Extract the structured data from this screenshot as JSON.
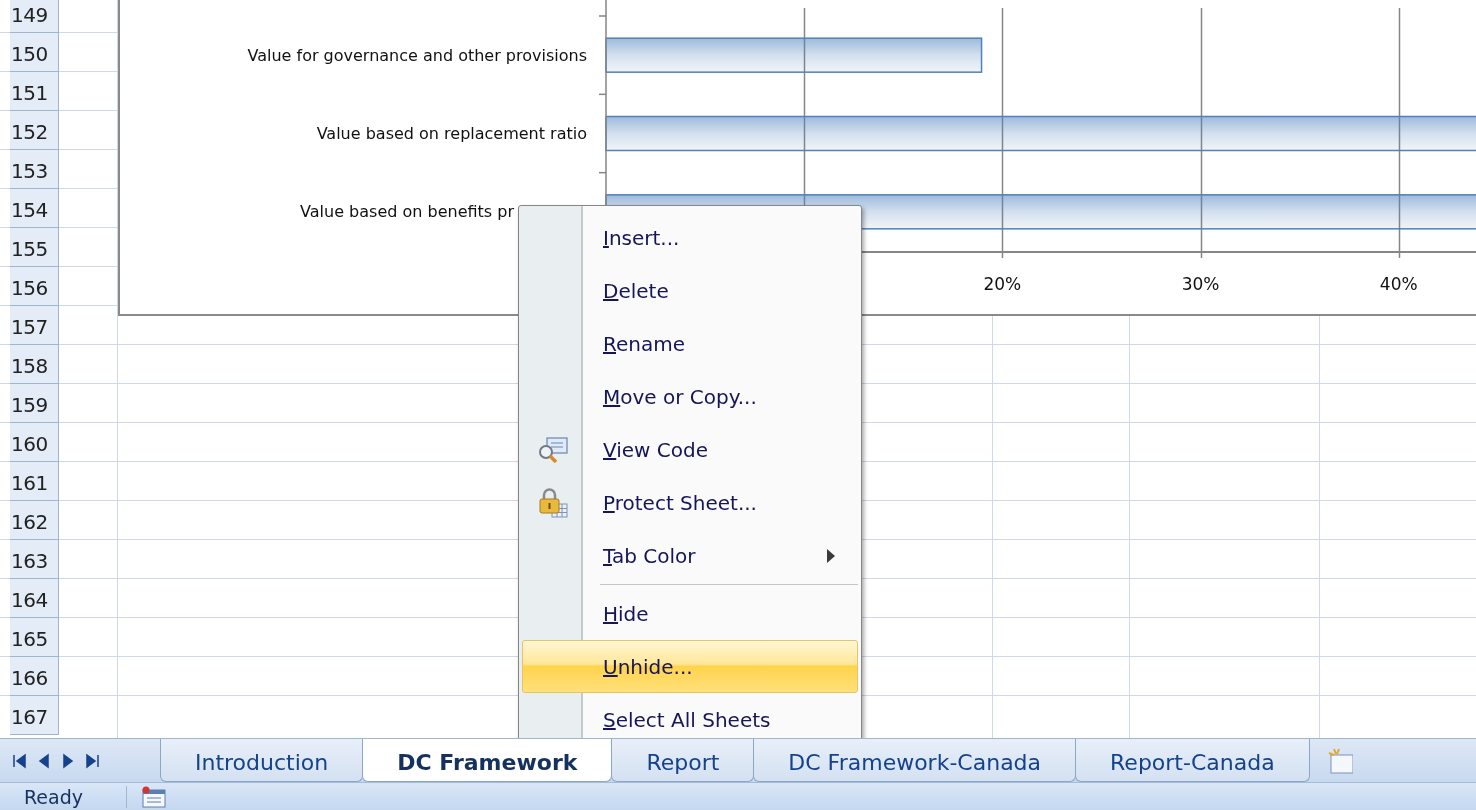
{
  "sheet": {
    "row_numbers": [
      "149",
      "150",
      "151",
      "152",
      "153",
      "154",
      "155",
      "156",
      "157",
      "158",
      "159",
      "160",
      "161",
      "162",
      "163",
      "164",
      "165",
      "166",
      "167"
    ]
  },
  "chart": {
    "category_labels": [
      "Value for governance and other provisions",
      "Value based on replacement ratio",
      "Value based on benefits pr"
    ],
    "chart_data": {
      "type": "bar",
      "orientation": "horizontal",
      "series": [
        {
          "color": "#4f81bd",
          "values": [
            0.19,
            0.44,
            0.44
          ]
        }
      ],
      "xlim": [
        0,
        0.44
      ],
      "grid": true,
      "xticks": [
        {
          "value": 0.2,
          "label": "20%"
        },
        {
          "value": 0.3,
          "label": "30%"
        },
        {
          "value": 0.4,
          "label": "40%"
        }
      ]
    }
  },
  "context_menu": {
    "items": [
      {
        "label": "Insert...",
        "underline_first": true,
        "kind": "plain",
        "selected": false,
        "separator_before": false
      },
      {
        "label": "Delete",
        "underline_first": true,
        "kind": "plain",
        "selected": false,
        "separator_before": false
      },
      {
        "label": "Rename",
        "underline_first": true,
        "kind": "plain",
        "selected": false,
        "separator_before": false
      },
      {
        "label": "Move or Copy...",
        "underline_first": true,
        "kind": "plain",
        "selected": false,
        "separator_before": false
      },
      {
        "label": "View Code",
        "underline_first": true,
        "kind": "code",
        "selected": false,
        "separator_before": false
      },
      {
        "label": "Protect Sheet...",
        "underline_first": true,
        "kind": "protect",
        "selected": false,
        "separator_before": false
      },
      {
        "label": "Tab Color",
        "underline_first": true,
        "kind": "submenu",
        "selected": false,
        "separator_before": false
      },
      {
        "label": "Hide",
        "underline_first": true,
        "kind": "plain",
        "selected": false,
        "separator_before": true
      },
      {
        "label": "Unhide...",
        "underline_first": true,
        "kind": "plain",
        "selected": true,
        "separator_before": false
      },
      {
        "label": "Select All Sheets",
        "underline_first": true,
        "kind": "plain",
        "selected": false,
        "separator_before": false
      }
    ]
  },
  "sheet_tabs": {
    "tabs": [
      {
        "label": "Introduction",
        "selected": false
      },
      {
        "label": "DC Framework",
        "selected": true
      },
      {
        "label": "Report",
        "selected": false
      },
      {
        "label": "DC Framework-Canada",
        "selected": false
      },
      {
        "label": "Report-Canada",
        "selected": false
      }
    ]
  },
  "status_bar": {
    "text": "Ready"
  }
}
